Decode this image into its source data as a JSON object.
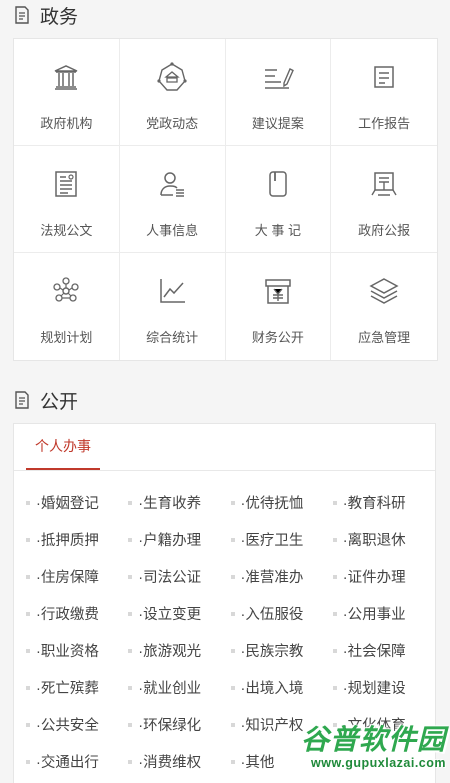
{
  "zhengwu": {
    "title": "政务",
    "items": [
      {
        "label": "政府机构",
        "icon": "government-building-icon"
      },
      {
        "label": "党政动态",
        "icon": "party-emblem-icon"
      },
      {
        "label": "建议提案",
        "icon": "proposal-pen-icon"
      },
      {
        "label": "工作报告",
        "icon": "report-document-icon"
      },
      {
        "label": "法规公文",
        "icon": "regulation-document-icon"
      },
      {
        "label": "人事信息",
        "icon": "personnel-icon"
      },
      {
        "label": "大 事 记",
        "icon": "chronicle-icon"
      },
      {
        "label": "政府公报",
        "icon": "gazette-icon"
      },
      {
        "label": "规划计划",
        "icon": "planning-network-icon"
      },
      {
        "label": "综合统计",
        "icon": "statistics-chart-icon"
      },
      {
        "label": "财务公开",
        "icon": "finance-icon"
      },
      {
        "label": "应急管理",
        "icon": "emergency-layers-icon"
      }
    ]
  },
  "gongkai": {
    "title": "公开",
    "active_tab": "个人办事",
    "items": [
      "·婚姻登记",
      "·生育收养",
      "·优待抚恤",
      "·教育科研",
      "·抵押质押",
      "·户籍办理",
      "·医疗卫生",
      "·离职退休",
      "·住房保障",
      "·司法公证",
      "·准营准办",
      "·证件办理",
      "·行政缴费",
      "·设立变更",
      "·入伍服役",
      "·公用事业",
      "·职业资格",
      "·旅游观光",
      "·民族宗教",
      "·社会保障",
      "·死亡殡葬",
      "·就业创业",
      "·出境入境",
      "·规划建设",
      "·公共安全",
      "·环保绿化",
      "·知识产权",
      "·文化体育",
      "·交通出行",
      "·消费维权",
      "·其他",
      ""
    ]
  },
  "watermark": {
    "text": "谷普软件园",
    "url": "www.gupuxlazai.com"
  },
  "colors": {
    "accent": "#c0392b",
    "icon": "#666666",
    "watermark": "#2fa84f"
  }
}
